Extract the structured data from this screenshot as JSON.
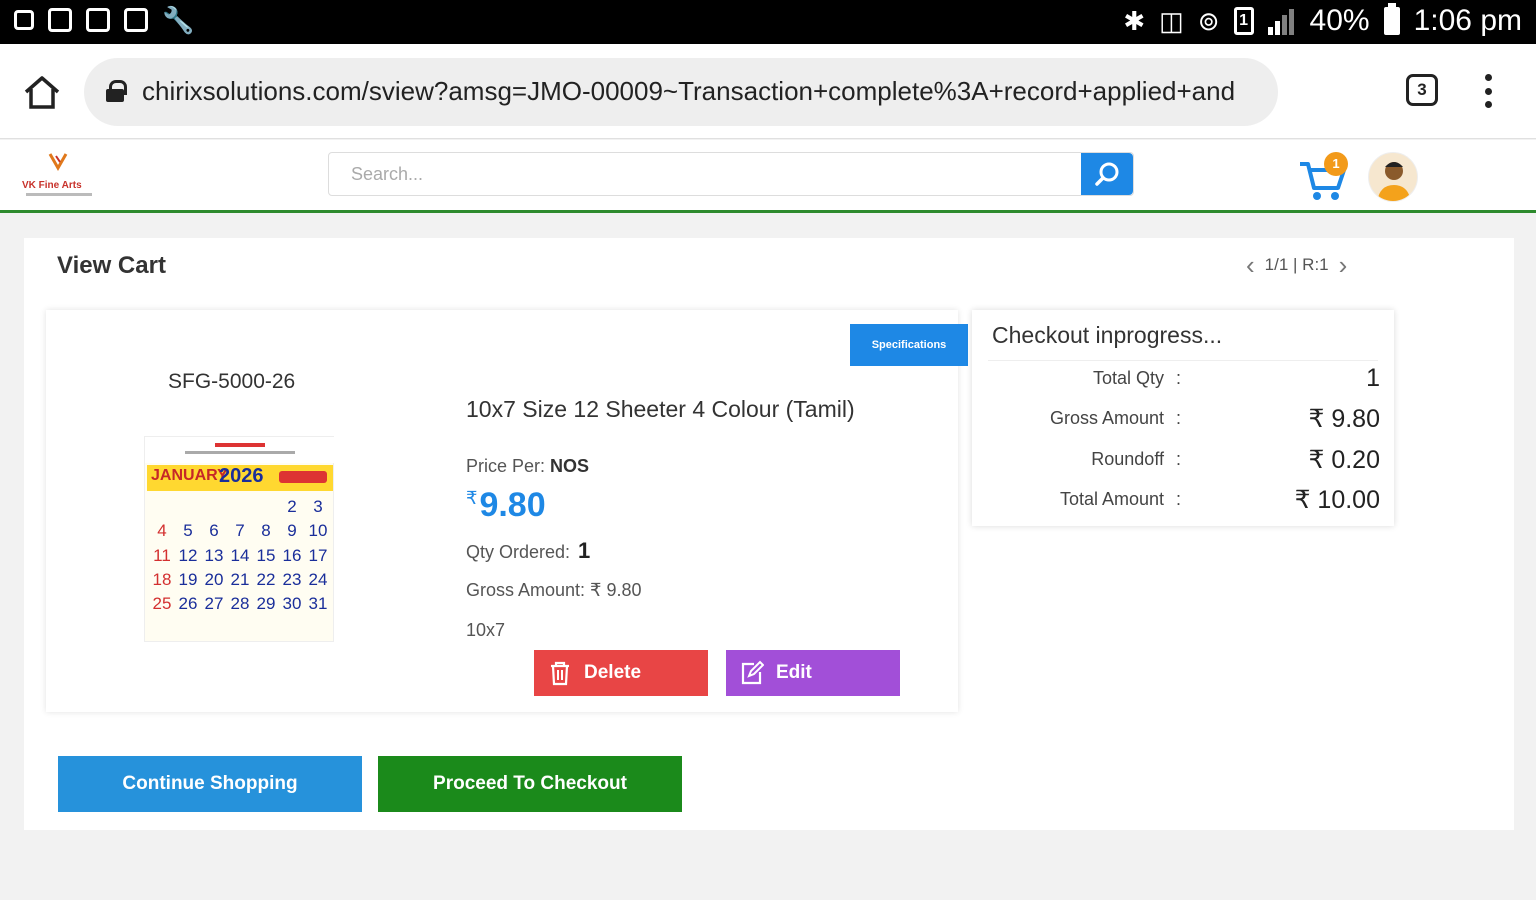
{
  "statusbar": {
    "battery": "40%",
    "time": "1:06 pm",
    "sim": "1"
  },
  "browser": {
    "url": "chirixsolutions.com/sview?amsg=JMO-00009~Transaction+complete%3A+record+applied+and",
    "tab_count": "3"
  },
  "header": {
    "logo_text": "VK Fine Arts",
    "search_placeholder": "Search...",
    "cart_count": "1"
  },
  "main": {
    "title": "View Cart",
    "pager": "1/1 | R:1"
  },
  "item": {
    "sku": "SFG-5000-26",
    "specifications_label": "Specifications",
    "name": "10x7 Size 12 Sheeter 4 Colour (Tamil)",
    "price_per_label": "Price Per:",
    "price_per_unit": "NOS",
    "currency_symbol": "₹",
    "price": "9.80",
    "qty_label": "Qty Ordered:",
    "qty": "1",
    "gross_text": "Gross Amount:  ₹ 9.80",
    "size": "10x7",
    "delete_label": "Delete",
    "edit_label": "Edit",
    "thumbnail": {
      "month": "JANUARY",
      "year": "2026",
      "days": [
        "",
        "",
        "",
        "",
        "",
        "2",
        "3",
        "4",
        "5",
        "6",
        "7",
        "8",
        "9",
        "10",
        "11",
        "12",
        "13",
        "14",
        "15",
        "16",
        "17",
        "18",
        "19",
        "20",
        "21",
        "22",
        "23",
        "24",
        "25",
        "26",
        "27",
        "28",
        "29",
        "30",
        "31",
        "",
        ""
      ]
    }
  },
  "summary": {
    "title": "Checkout inprogress...",
    "rows": [
      {
        "label": "Total Qty",
        "value": "1"
      },
      {
        "label": "Gross Amount",
        "value": "₹ 9.80"
      },
      {
        "label": "Roundoff",
        "value": "₹ 0.20"
      },
      {
        "label": "Total Amount",
        "value": "₹ 10.00"
      }
    ]
  },
  "actions": {
    "continue_label": "Continue Shopping",
    "checkout_label": "Proceed To Checkout"
  },
  "colors": {
    "primary_blue": "#1e88e5",
    "green": "#1b8a1b",
    "delete_red": "#e84545",
    "edit_purple": "#a24fd8",
    "cart_badge": "#f29a1a"
  }
}
